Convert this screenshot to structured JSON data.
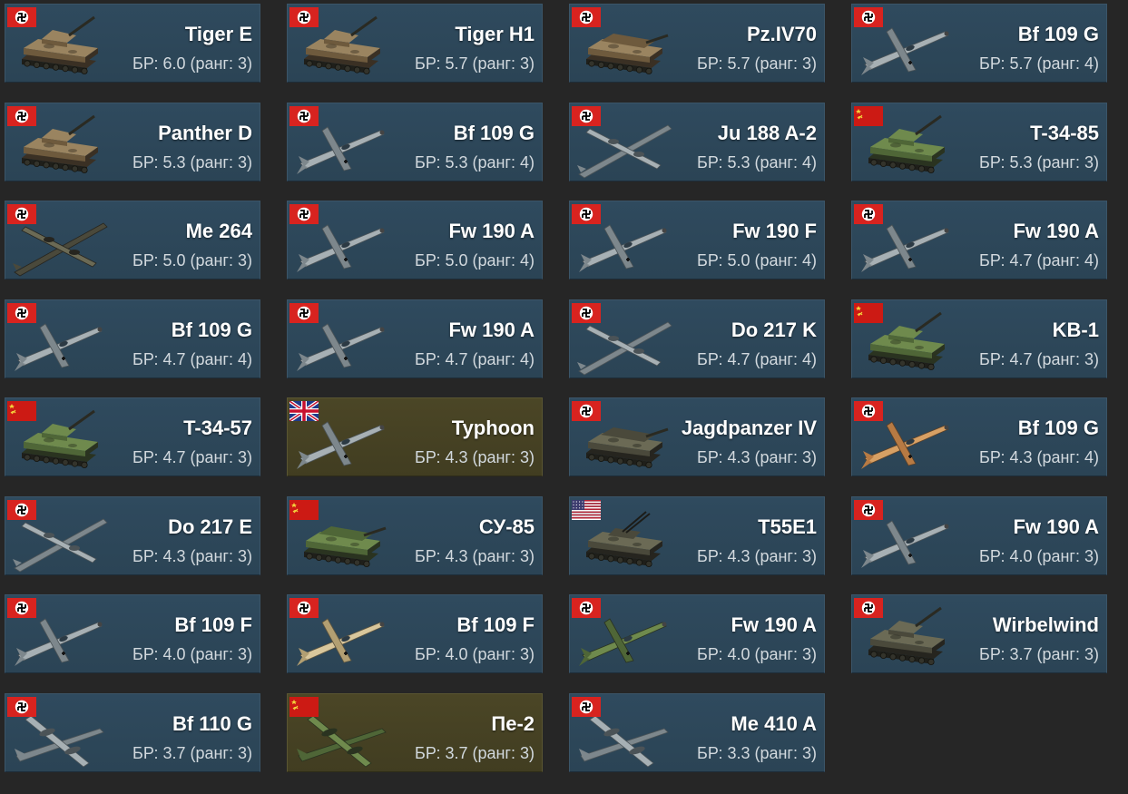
{
  "palette": {
    "background": "#262626",
    "card": "#2d4659",
    "card_premium": "#474223",
    "name_text": "#ffffff",
    "br_text": "#d2d9de"
  },
  "vehicles": [
    {
      "name": "Tiger E",
      "br": "БР: 6.0 (ранг: 3)",
      "nation": "germany",
      "kind": "tank",
      "camo": "tan",
      "icon": "tiger-tank-icon"
    },
    {
      "name": "Tiger H1",
      "br": "БР: 5.7 (ранг: 3)",
      "nation": "germany",
      "kind": "tank",
      "camo": "tan",
      "icon": "tiger-tank-icon"
    },
    {
      "name": "Pz.IV70",
      "br": "БР: 5.7 (ранг: 3)",
      "nation": "germany",
      "kind": "spg",
      "camo": "tan",
      "icon": "tank-destroyer-icon"
    },
    {
      "name": "Bf 109 G",
      "br": "БР: 5.7 (ранг: 4)",
      "nation": "germany",
      "kind": "fighter",
      "camo": "grey",
      "icon": "fighter-plane-icon"
    },
    {
      "name": "Panther D",
      "br": "БР: 5.3 (ранг: 3)",
      "nation": "germany",
      "kind": "tank",
      "camo": "tan",
      "icon": "panther-tank-icon"
    },
    {
      "name": "Bf 109 G",
      "br": "БР: 5.3 (ранг: 4)",
      "nation": "germany",
      "kind": "fighter",
      "camo": "grey",
      "icon": "fighter-plane-icon"
    },
    {
      "name": "Ju 188 A-2",
      "br": "БР: 5.3 (ранг: 4)",
      "nation": "germany",
      "kind": "bomber",
      "camo": "grey",
      "icon": "bomber-plane-icon"
    },
    {
      "name": "T-34-85",
      "br": "БР: 5.3 (ранг: 3)",
      "nation": "ussr",
      "kind": "tank",
      "camo": "green",
      "icon": "t34-tank-icon"
    },
    {
      "name": "Me 264",
      "br": "БР: 5.0 (ранг: 3)",
      "nation": "germany",
      "kind": "bomber",
      "camo": "dark",
      "icon": "bomber-plane-icon"
    },
    {
      "name": "Fw 190 A",
      "br": "БР: 5.0 (ранг: 4)",
      "nation": "germany",
      "kind": "fighter",
      "camo": "grey",
      "icon": "fighter-plane-icon"
    },
    {
      "name": "Fw 190 F",
      "br": "БР: 5.0 (ранг: 4)",
      "nation": "germany",
      "kind": "fighter",
      "camo": "grey",
      "icon": "fighter-plane-icon"
    },
    {
      "name": "Fw 190 A",
      "br": "БР: 4.7 (ранг: 4)",
      "nation": "germany",
      "kind": "fighter",
      "camo": "grey",
      "icon": "fighter-plane-icon"
    },
    {
      "name": "Bf 109 G",
      "br": "БР: 4.7 (ранг: 4)",
      "nation": "germany",
      "kind": "fighter",
      "camo": "grey",
      "icon": "fighter-plane-icon"
    },
    {
      "name": "Fw 190 A",
      "br": "БР: 4.7 (ранг: 4)",
      "nation": "germany",
      "kind": "fighter",
      "camo": "grey",
      "icon": "fighter-plane-icon"
    },
    {
      "name": "Do 217 K",
      "br": "БР: 4.7 (ранг: 4)",
      "nation": "germany",
      "kind": "bomber",
      "camo": "grey",
      "icon": "bomber-plane-icon"
    },
    {
      "name": "KB-1",
      "br": "БР: 4.7 (ранг: 3)",
      "nation": "ussr",
      "kind": "tank",
      "camo": "green",
      "icon": "heavy-tank-icon"
    },
    {
      "name": "T-34-57",
      "br": "БР: 4.7 (ранг: 3)",
      "nation": "ussr",
      "kind": "tank",
      "camo": "green",
      "icon": "t34-tank-icon"
    },
    {
      "name": "Typhoon",
      "br": "БР: 4.3 (ранг: 3)",
      "nation": "uk",
      "kind": "fighter",
      "camo": "grey",
      "icon": "fighter-plane-icon",
      "premium": true
    },
    {
      "name": "Jagdpanzer IV",
      "br": "БР: 4.3 (ранг: 3)",
      "nation": "germany",
      "kind": "spg",
      "camo": "dark",
      "icon": "tank-destroyer-icon"
    },
    {
      "name": "Bf 109 G",
      "br": "БР: 4.3 (ранг: 4)",
      "nation": "germany",
      "kind": "fighter",
      "camo": "orange",
      "icon": "fighter-plane-icon"
    },
    {
      "name": "Do 217 E",
      "br": "БР: 4.3 (ранг: 3)",
      "nation": "germany",
      "kind": "bomber",
      "camo": "grey",
      "icon": "bomber-plane-icon"
    },
    {
      "name": "СУ-85",
      "br": "БР: 4.3 (ранг: 3)",
      "nation": "ussr",
      "kind": "spg",
      "camo": "green",
      "icon": "tank-destroyer-icon"
    },
    {
      "name": "T55E1",
      "br": "БР: 4.3 (ранг: 3)",
      "nation": "usa",
      "kind": "spaa",
      "camo": "dark",
      "icon": "halftrack-icon"
    },
    {
      "name": "Fw 190 A",
      "br": "БР: 4.0 (ранг: 3)",
      "nation": "germany",
      "kind": "fighter",
      "camo": "grey",
      "icon": "fighter-plane-icon"
    },
    {
      "name": "Bf 109 F",
      "br": "БР: 4.0 (ранг: 3)",
      "nation": "germany",
      "kind": "fighter",
      "camo": "grey",
      "icon": "fighter-plane-icon"
    },
    {
      "name": "Bf 109 F",
      "br": "БР: 4.0 (ранг: 3)",
      "nation": "germany",
      "kind": "fighter",
      "camo": "sand",
      "icon": "fighter-plane-icon"
    },
    {
      "name": "Fw 190 A",
      "br": "БР: 4.0 (ранг: 3)",
      "nation": "germany",
      "kind": "fighter",
      "camo": "green",
      "icon": "fighter-plane-icon"
    },
    {
      "name": "Wirbelwind",
      "br": "БР: 3.7 (ранг: 3)",
      "nation": "germany",
      "kind": "tank",
      "camo": "dark",
      "icon": "spaa-tank-icon"
    },
    {
      "name": "Bf 110 G",
      "br": "БР: 3.7 (ранг: 3)",
      "nation": "germany",
      "kind": "bomber",
      "camo": "grey",
      "icon": "twin-engine-plane-icon"
    },
    {
      "name": "Пе-2",
      "br": "БР: 3.7 (ранг: 3)",
      "nation": "ussr",
      "kind": "bomber",
      "camo": "green",
      "icon": "twin-engine-plane-icon",
      "premium": true
    },
    {
      "name": "Me 410 A",
      "br": "БР: 3.3 (ранг: 3)",
      "nation": "germany",
      "kind": "bomber",
      "camo": "grey",
      "icon": "twin-engine-plane-icon"
    }
  ]
}
